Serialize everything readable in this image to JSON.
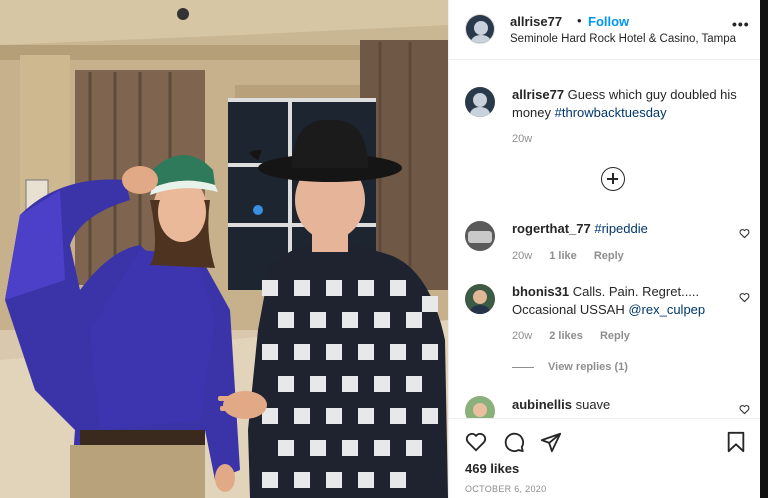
{
  "post": {
    "username": "allrise77",
    "dot": "•",
    "follow_label": "Follow",
    "location": "Seminole Hard Rock Hotel & Casino, Tampa",
    "more_icon": "more-horizontal-icon",
    "caption_text": "Guess which guy doubled his money",
    "caption_hashtag": "#throwbacktuesday",
    "caption_time": "20w"
  },
  "comments": [
    {
      "username": "rogerthat_77",
      "text": "",
      "mention": "#ripeddie",
      "time": "20w",
      "likes": "1 like",
      "reply": "Reply"
    },
    {
      "username": "bhonis31",
      "text": "Calls. Pain. Regret..... Occasional USSAH",
      "mention": "@rex_culpep",
      "time": "20w",
      "likes": "2 likes",
      "reply": "Reply",
      "view_replies": "View replies (1)"
    },
    {
      "username": "aubinellis",
      "text": "suave"
    }
  ],
  "footer": {
    "likes": "469 likes",
    "date": "OCTOBER 6, 2020"
  },
  "icons": [
    "heart-icon",
    "comment-icon",
    "share-icon",
    "bookmark-icon",
    "add-comment-icon"
  ],
  "colors": {
    "follow": "#0095f6",
    "hashtag": "#00376b",
    "muted": "#8e8e8e"
  }
}
